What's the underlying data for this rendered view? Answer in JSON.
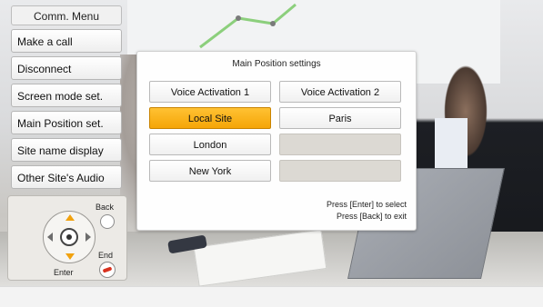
{
  "menu": {
    "title": "Comm. Menu",
    "items": [
      {
        "label": "Make a call"
      },
      {
        "label": "Disconnect"
      },
      {
        "label": "Screen mode set."
      },
      {
        "label": "Main Position set."
      },
      {
        "label": "Site name display"
      },
      {
        "label": "Other Site's Audio"
      }
    ]
  },
  "remote": {
    "back_label": "Back",
    "enter_label": "Enter",
    "end_label": "End"
  },
  "dialog": {
    "title": "Main Position settings",
    "options": [
      {
        "label": "Voice Activation 1",
        "state": "normal"
      },
      {
        "label": "Voice Activation 2",
        "state": "normal"
      },
      {
        "label": "Local Site",
        "state": "selected"
      },
      {
        "label": "Paris",
        "state": "normal"
      },
      {
        "label": "London",
        "state": "normal"
      },
      {
        "label": "",
        "state": "disabled"
      },
      {
        "label": "New York",
        "state": "normal"
      },
      {
        "label": "",
        "state": "disabled"
      }
    ],
    "hint_select": "Press [Enter] to select",
    "hint_exit": "Press [Back] to exit"
  },
  "colors": {
    "selected_accent": "#f5a507",
    "disabled_fill": "#dcd9d3",
    "end_button_red": "#d8321f"
  }
}
